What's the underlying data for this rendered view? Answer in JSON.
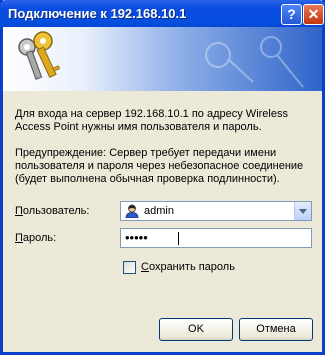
{
  "window": {
    "title": "Подключение к 192.168.10.1"
  },
  "titlebar": {
    "help_label": "?",
    "close_label": "✕"
  },
  "banner": {
    "icon": "keys-icon"
  },
  "message": {
    "line1": "Для входа на сервер 192.168.10.1 по адресу Wireless",
    "line2": "Access Point нужны имя пользователя и пароль."
  },
  "warning": {
    "line1": "Предупреждение: Сервер требует передачи имени",
    "line2": "пользователя и пароля через небезопасное соединение",
    "line3": "(будет выполнена обычная проверка подлинности)."
  },
  "username": {
    "label_first": "П",
    "label_rest": "ользователь:",
    "value": "admin",
    "icon": "user-icon"
  },
  "password": {
    "label_first": "П",
    "label_rest": "ароль:",
    "value": "•••••"
  },
  "remember": {
    "label_first": "С",
    "label_rest": "охранить пароль",
    "checked": false
  },
  "buttons": {
    "ok": "OK",
    "cancel": "Отмена"
  },
  "colors": {
    "titlebar": "#0a4be0",
    "dialog_bg": "#ece9d8",
    "field_border": "#7f9db9"
  }
}
